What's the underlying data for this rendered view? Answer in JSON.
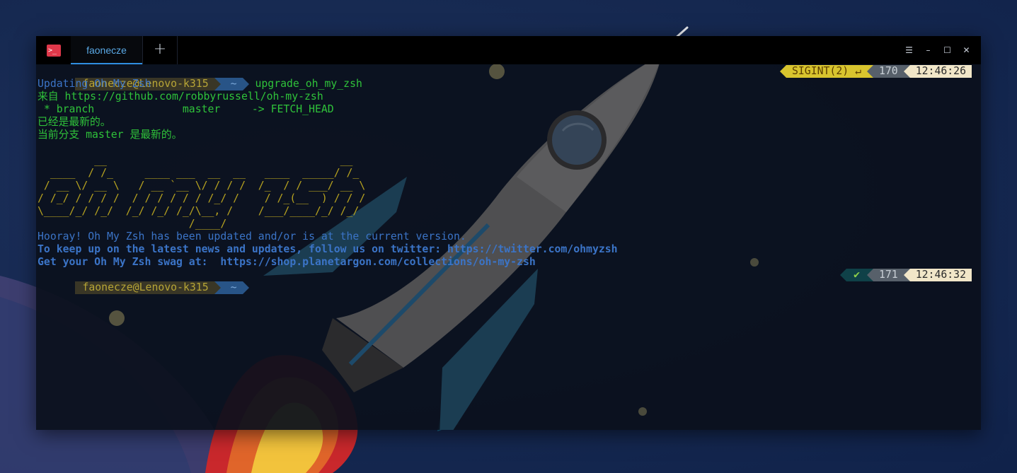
{
  "window": {
    "app_icon_glyph": ">_",
    "tabs": [
      {
        "label": "faonecze",
        "active": true
      }
    ],
    "add_tab_glyph": "+",
    "controls": {
      "menu": "☰",
      "minimize": "–",
      "maximize": "☐",
      "close": "✕"
    }
  },
  "terminal": {
    "prompt1": {
      "user": "faonecze@Lenovo-k315",
      "dir": "~",
      "command": "upgrade_oh_my_zsh",
      "status": "SIGINT(2) ↵",
      "history": "170",
      "time": "12:46:26"
    },
    "output": {
      "updating": "Updating Oh My Zsh",
      "from": "来自 https://github.com/robbyrussell/oh-my-zsh",
      "branch": " * branch              master     -> FETCH_HEAD",
      "uptodate": "已经是最新的。",
      "current_branch": "当前分支 master 是最新的。",
      "banner": [
        "         __                                     __   ",
        "  ____  / /_     ____ ___  __  __   ____  _____/ /_  ",
        " / __ \\/ __ \\   / __ `__ \\/ / / /  /_  / / ___/ __ \\ ",
        "/ /_/ / / / /  / / / / / / /_/ /    / /_(__  ) / / / ",
        "\\____/_/ /_/  /_/ /_/ /_/\\__, /    /___/____/_/ /_/  ",
        "                        /____/                       "
      ],
      "hooray": "Hooray! Oh My Zsh has been updated and/or is at the current version.",
      "twitter": "To keep up on the latest news and updates, follow us on twitter: https://twitter.com/ohmyzsh",
      "swag": "Get your Oh My Zsh swag at:  https://shop.planetargon.com/collections/oh-my-zsh"
    },
    "prompt2": {
      "user": "faonecze@Lenovo-k315",
      "dir": "~",
      "status": "✔",
      "history": "171",
      "time": "12:46:32"
    }
  },
  "colors": {
    "desktop": "#172a52",
    "terminal_bg": "#0b101c",
    "green": "#2fc23a",
    "blue": "#3b74c7",
    "yellow": "#b6a21f",
    "tab_accent": "#2f8ee0"
  }
}
